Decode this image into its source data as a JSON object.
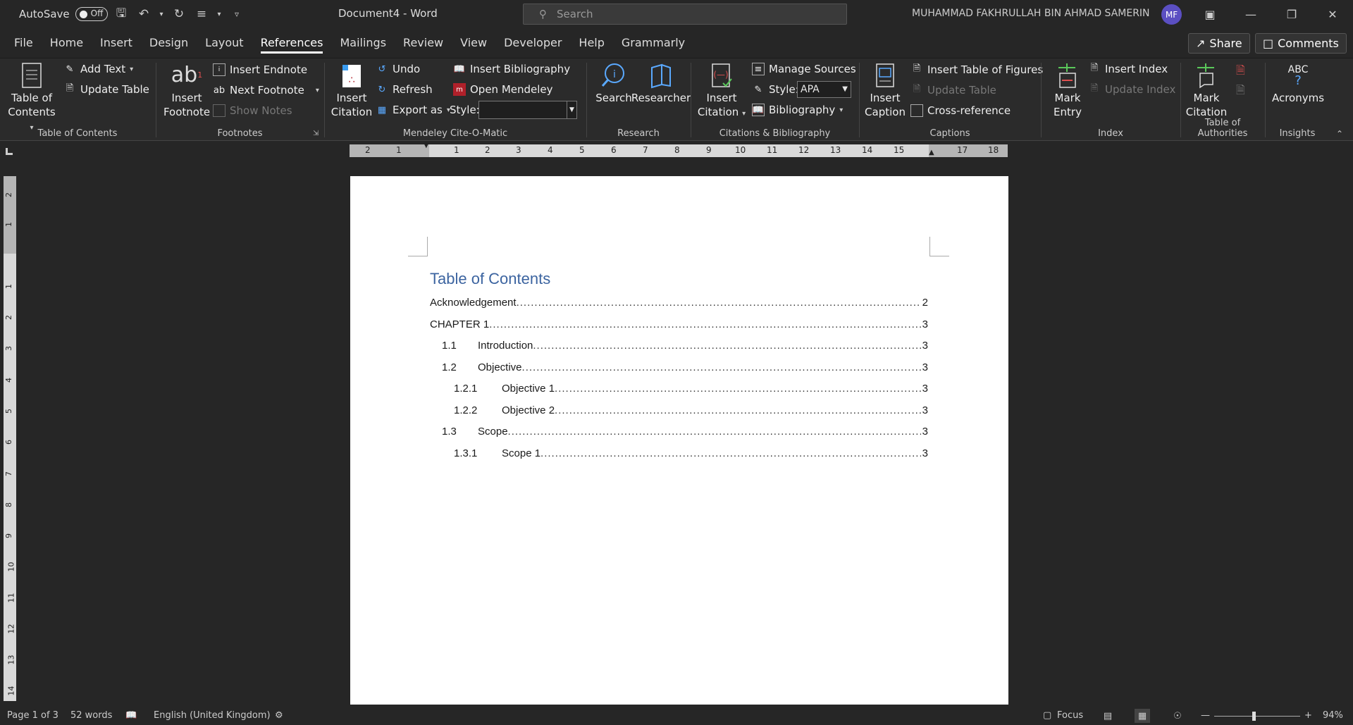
{
  "titlebar": {
    "autosave_label": "AutoSave",
    "autosave_state": "Off",
    "document_title": "Document4  -  Word",
    "search_placeholder": "Search",
    "user_name": "MUHAMMAD FAKHRULLAH BIN AHMAD SAMERIN",
    "user_initials": "MF"
  },
  "tabs": [
    "File",
    "Home",
    "Insert",
    "Design",
    "Layout",
    "References",
    "Mailings",
    "Review",
    "View",
    "Developer",
    "Help",
    "Grammarly"
  ],
  "active_tab": "References",
  "share_label": "Share",
  "comments_label": "Comments",
  "ribbon": {
    "toc_group": {
      "label": "Table of Contents",
      "toc_button": "Table of",
      "toc_button2": "Contents",
      "add_text": "Add Text",
      "update_table": "Update Table"
    },
    "footnotes_group": {
      "label": "Footnotes",
      "insert_footnote": "Insert",
      "insert_footnote2": "Footnote",
      "insert_endnote": "Insert Endnote",
      "next_footnote": "Next Footnote",
      "show_notes": "Show Notes"
    },
    "mendeley_group": {
      "label": "Mendeley Cite-O-Matic",
      "insert_citation": "Insert",
      "insert_citation2": "Citation",
      "undo": "Undo",
      "refresh": "Refresh",
      "export_as": "Export as",
      "insert_bibliography": "Insert Bibliography",
      "open_mendeley": "Open Mendeley",
      "style_label": "Style:"
    },
    "research_group": {
      "label": "Research",
      "search": "Search",
      "researcher": "Researcher"
    },
    "citations_group": {
      "label": "Citations & Bibliography",
      "insert_citation": "Insert",
      "insert_citation2": "Citation",
      "manage_sources": "Manage Sources",
      "style_label": "Style:",
      "style_value": "APA",
      "bibliography": "Bibliography"
    },
    "captions_group": {
      "label": "Captions",
      "insert_caption": "Insert",
      "insert_caption2": "Caption",
      "insert_table_of_figures": "Insert Table of Figures",
      "update_table": "Update Table",
      "cross_reference": "Cross-reference"
    },
    "index_group": {
      "label": "Index",
      "mark_entry": "Mark",
      "mark_entry2": "Entry",
      "insert_index": "Insert Index",
      "update_index": "Update Index"
    },
    "authorities_group": {
      "label": "Table of Authorities",
      "mark_citation": "Mark",
      "mark_citation2": "Citation"
    },
    "insights_group": {
      "label": "Insights",
      "acronyms": "Acronyms",
      "acronyms_icon_text": "ABC"
    }
  },
  "ruler": {
    "h_ticks": [
      "2",
      "1",
      "1",
      "1",
      "2",
      "3",
      "4",
      "5",
      "6",
      "7",
      "8",
      "9",
      "10",
      "11",
      "12",
      "13",
      "14",
      "15",
      "17",
      "18"
    ],
    "v_ticks": [
      "2",
      "1",
      "1",
      "1",
      "2",
      "3",
      "4",
      "5",
      "6",
      "7",
      "8",
      "9",
      "10",
      "11",
      "12",
      "13",
      "14"
    ]
  },
  "document": {
    "toc_title": "Table of Contents",
    "entries": [
      {
        "num": "",
        "text": "Acknowledgement",
        "page": "2",
        "level": 0
      },
      {
        "num": "",
        "text": "CHAPTER 1",
        "page": "3",
        "level": 0
      },
      {
        "num": "1.1",
        "text": "Introduction",
        "page": "3",
        "level": 1
      },
      {
        "num": "1.2",
        "text": "Objective",
        "page": "3",
        "level": 1
      },
      {
        "num": "1.2.1",
        "text": "Objective 1",
        "page": "3",
        "level": 2
      },
      {
        "num": "1.2.2",
        "text": "Objective 2",
        "page": "3",
        "level": 2
      },
      {
        "num": "1.3",
        "text": "Scope",
        "page": "3",
        "level": 1
      },
      {
        "num": "1.3.1",
        "text": "Scope 1",
        "page": "3",
        "level": 2
      }
    ]
  },
  "statusbar": {
    "page": "Page 1 of 3",
    "words": "52 words",
    "language": "English (United Kingdom)",
    "focus": "Focus",
    "zoom": "94%"
  }
}
